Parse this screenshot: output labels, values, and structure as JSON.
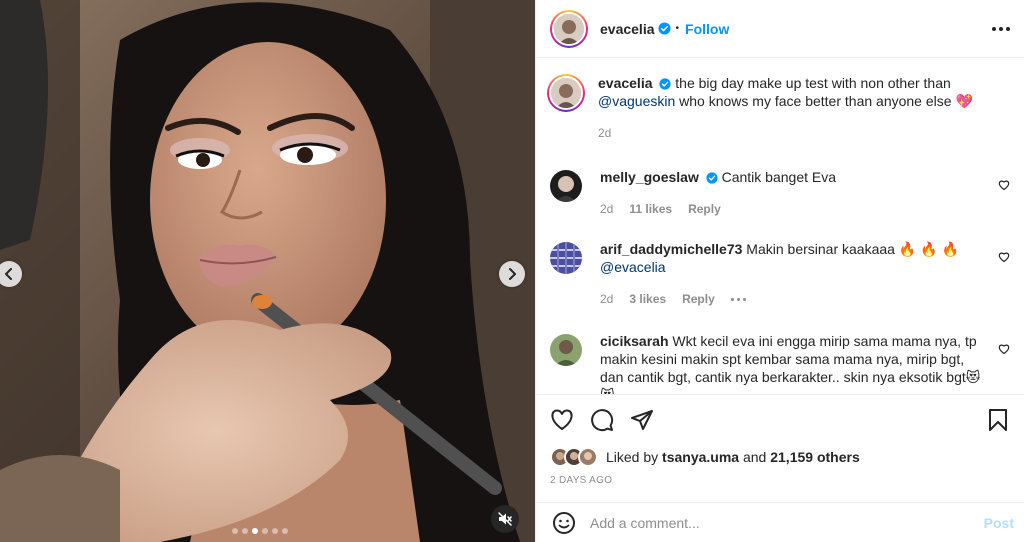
{
  "media": {
    "slide_count": 6,
    "active_slide": 3,
    "prev_icon": "chevron-left-icon",
    "next_icon": "chevron-right-icon",
    "mute_icon": "speaker-muted-icon"
  },
  "header": {
    "username": "evacelia",
    "separator": "•",
    "follow_label": "Follow",
    "more_icon": "more-horizontal-icon"
  },
  "caption": {
    "username": "evacelia",
    "text_before": "the big day make up test with non other than",
    "mention": "@vagueskin",
    "text_after": "who knows my face better than anyone else",
    "emoji": "💖",
    "time": "2d"
  },
  "comments": [
    {
      "username": "melly_goeslaw",
      "verified": true,
      "text": "Cantik banget Eva",
      "time": "2d",
      "likes": "11 likes",
      "reply_label": "Reply"
    },
    {
      "username": "arif_daddymichelle73",
      "verified": false,
      "text": "Makin bersinar kaakaaa 🔥 🔥 🔥",
      "mention": "@evacelia",
      "time": "2d",
      "likes": "3 likes",
      "reply_label": "Reply"
    },
    {
      "username": "ciciksarah",
      "verified": false,
      "text": "Wkt kecil eva ini engga mirip sama mama nya, tp makin kesini makin spt kembar sama mama nya, mirip bgt, dan cantik bgt, cantik nya berkarakter.. skin nya eksotik bgt😻 😻"
    }
  ],
  "actions": {
    "like_icon": "heart-icon",
    "comment_icon": "comment-icon",
    "share_icon": "share-icon",
    "save_icon": "bookmark-icon"
  },
  "likes": {
    "prefix": "Liked by",
    "user": "tsanya.uma",
    "middle": "and",
    "others": "21,159 others"
  },
  "time_ago": "2 DAYS AGO",
  "add_comment": {
    "placeholder": "Add a comment...",
    "post_label": "Post",
    "emoji_icon": "smiley-icon"
  },
  "colors": {
    "accent": "#0095f6",
    "verified": "#0095f6",
    "post_disabled": "#b2dffc",
    "muted_text": "#8e8e8e"
  }
}
